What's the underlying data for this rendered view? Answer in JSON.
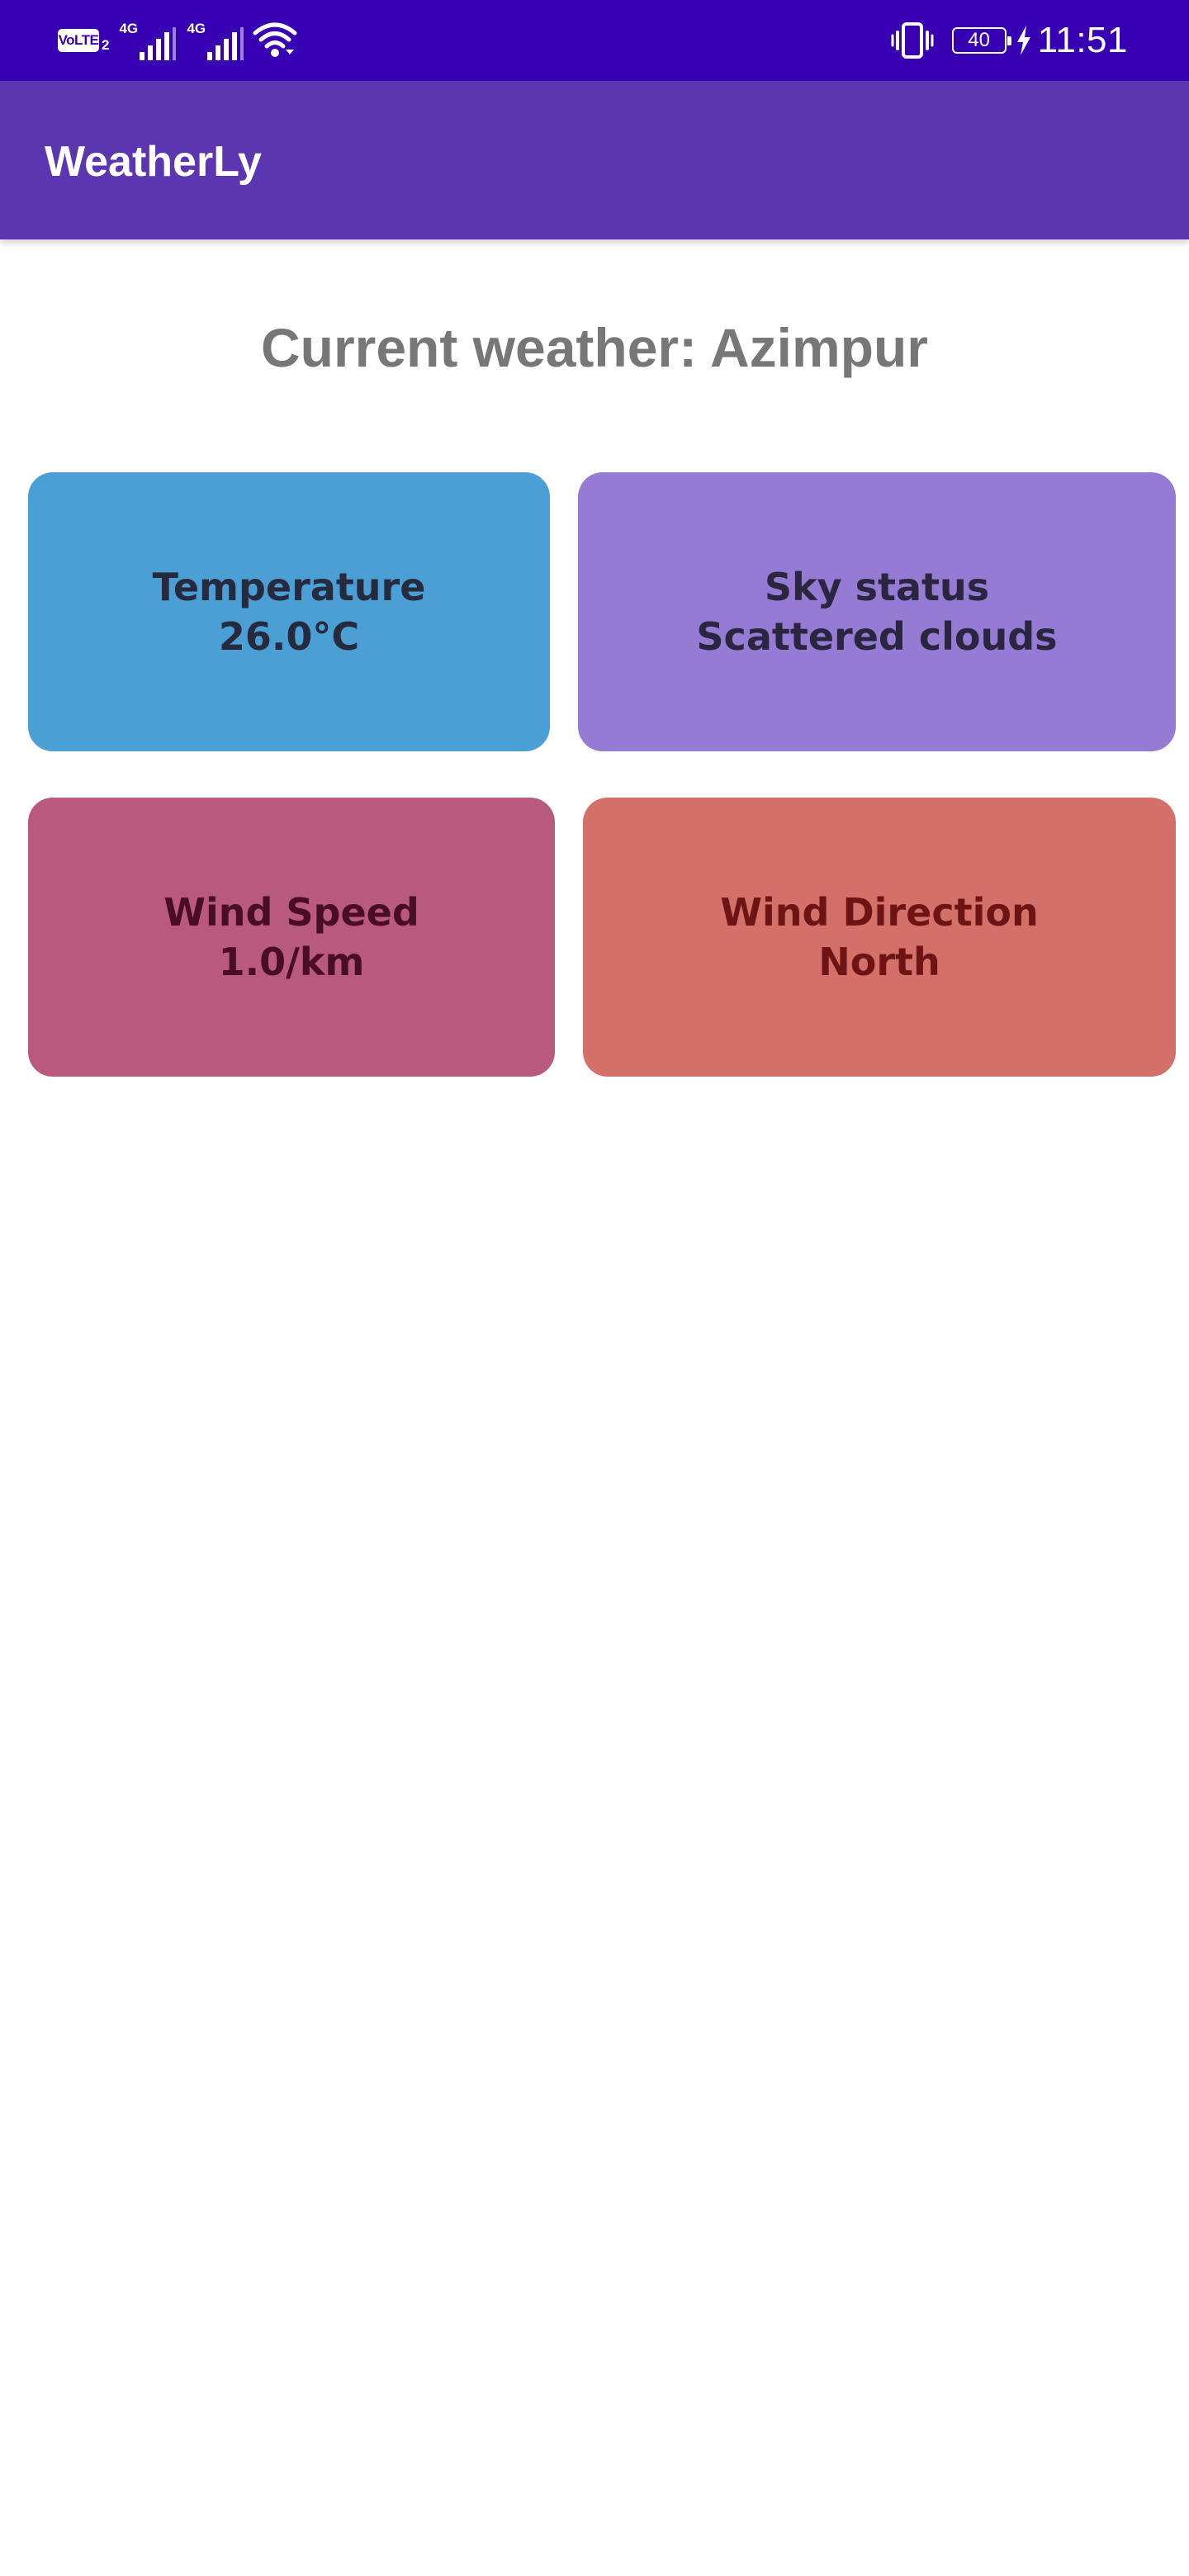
{
  "status_bar": {
    "volte_label": "VoLTE",
    "sim_number": "2",
    "sim1_network": "4G",
    "sim2_network": "4G",
    "battery_level": "40",
    "clock": "11:51",
    "icons": [
      "volte-icon",
      "signal-icon",
      "signal-icon",
      "wifi-icon",
      "vibrate-icon",
      "battery-icon",
      "charging-bolt-icon"
    ]
  },
  "app_bar": {
    "title": "WeatherLy"
  },
  "main": {
    "heading": "Current weather: Azimpur",
    "cards": {
      "temperature": {
        "label": "Temperature",
        "value": "26.0°C",
        "color": "#4b9fd4"
      },
      "sky": {
        "label": "Sky status",
        "value": "Scattered clouds",
        "color": "#957bd3"
      },
      "wind_speed": {
        "label": "Wind Speed",
        "value": "1.0/km",
        "color": "#b9597e"
      },
      "wind_direction": {
        "label": "Wind Direction",
        "value": "North",
        "color": "#d4706a"
      }
    }
  },
  "colors": {
    "status_bar": "#3700b3",
    "app_bar": "#5c35b0",
    "heading_text": "#777777"
  }
}
